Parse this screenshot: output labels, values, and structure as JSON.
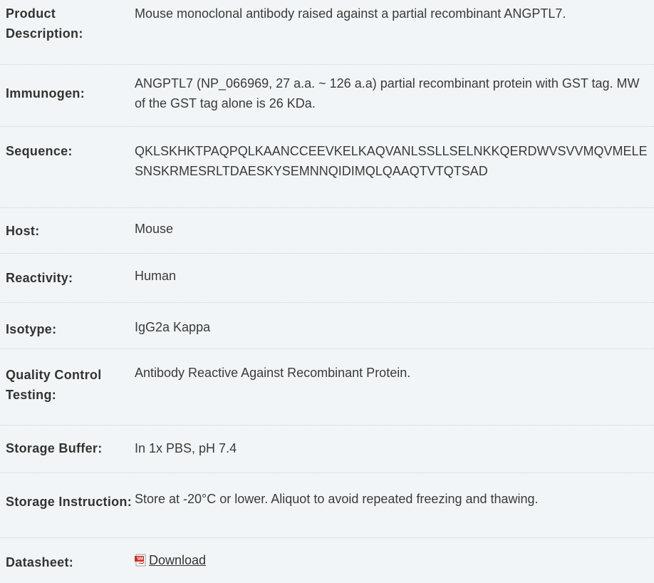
{
  "rows": [
    {
      "label": "Product Description:",
      "value": "Mouse monoclonal antibody raised against a partial recombinant ANGPTL7."
    },
    {
      "label": "Immunogen:",
      "value": "ANGPTL7 (NP_066969, 27 a.a. ~ 126 a.a) partial recombinant protein with GST tag. MW of the GST tag alone is 26 KDa."
    },
    {
      "label": "Sequence:",
      "value": "QKLSKHKTPAQPQLKAANCCEEVKELKAQVANLSSLLSELNKKQERDWVSVVMQVMELESNSKRMESRLTDAESKYSEMNNQIDIMQLQAAQTVTQTSAD"
    },
    {
      "label": "Host:",
      "value": "Mouse"
    },
    {
      "label": "Reactivity:",
      "value": "Human"
    },
    {
      "label": "Isotype:",
      "value": "IgG2a Kappa"
    },
    {
      "label": "Quality Control Testing:",
      "value": "Antibody Reactive Against Recombinant Protein."
    },
    {
      "label": "Storage Buffer:",
      "value": "In 1x PBS, pH 7.4"
    },
    {
      "label": "Storage Instruction:",
      "value": "Store at -20°C or lower. Aliquot to avoid repeated freezing and thawing."
    },
    {
      "label": "Datasheet:",
      "value": "Download"
    }
  ],
  "icons": {
    "datasheet": "pdf-icon"
  },
  "colors": {
    "background": "#f2f5f7",
    "text": "#333333",
    "divider": "#c9cfd4",
    "pdf_red": "#d42a20"
  }
}
